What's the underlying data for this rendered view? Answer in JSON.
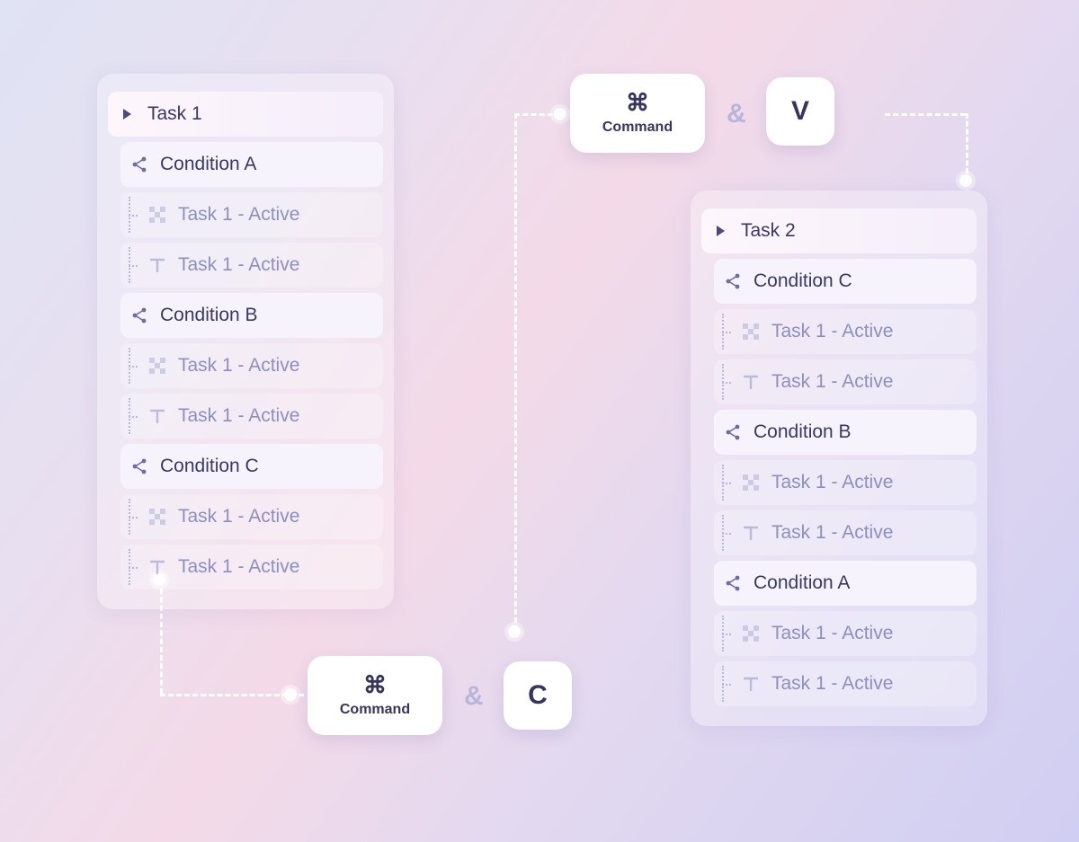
{
  "shortcut_top": {
    "key1": "Command",
    "glyph": "⌘",
    "amp": "&",
    "key2": "V"
  },
  "shortcut_bottom": {
    "key1": "Command",
    "glyph": "⌘",
    "amp": "&",
    "key2": "C"
  },
  "panel_left": {
    "task": "Task 1",
    "groups": [
      {
        "condition": "Condition A",
        "items": [
          "Task 1 - Active",
          "Task 1 - Active"
        ]
      },
      {
        "condition": "Condition B",
        "items": [
          "Task 1 - Active",
          "Task 1 - Active"
        ]
      },
      {
        "condition": "Condition C",
        "items": [
          "Task 1 - Active",
          "Task 1 - Active"
        ]
      }
    ]
  },
  "panel_right": {
    "task": "Task 2",
    "groups": [
      {
        "condition": "Condition C",
        "items": [
          "Task 1 - Active",
          "Task 1 - Active"
        ]
      },
      {
        "condition": "Condition B",
        "items": [
          "Task 1 - Active",
          "Task 1 - Active"
        ]
      },
      {
        "condition": "Condition A",
        "items": [
          "Task 1 - Active",
          "Task 1 - Active"
        ]
      }
    ]
  }
}
